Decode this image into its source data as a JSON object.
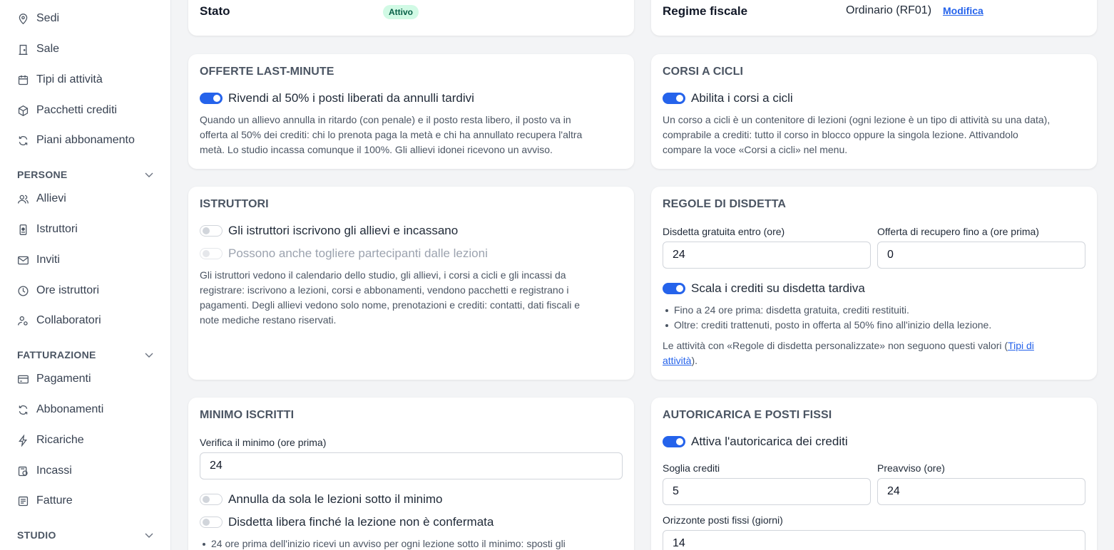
{
  "sidebar": {
    "top_items": [
      {
        "label": "Sedi",
        "icon": "map-pin-icon"
      },
      {
        "label": "Sale",
        "icon": "door-icon"
      },
      {
        "label": "Tipi di attività",
        "icon": "calendar-icon"
      },
      {
        "label": "Pacchetti crediti",
        "icon": "package-icon"
      },
      {
        "label": "Piani abbonamento",
        "icon": "refresh-icon"
      }
    ],
    "sections": {
      "persone": {
        "label": "PERSONE",
        "items": [
          {
            "label": "Allievi",
            "icon": "users-icon"
          },
          {
            "label": "Istruttori",
            "icon": "badge-icon"
          },
          {
            "label": "Inviti",
            "icon": "mail-icon"
          },
          {
            "label": "Ore istruttori",
            "icon": "clock-icon"
          },
          {
            "label": "Collaboratori",
            "icon": "user-cog-icon"
          }
        ]
      },
      "fatturazione": {
        "label": "FATTURAZIONE",
        "items": [
          {
            "label": "Pagamenti",
            "icon": "credit-card-icon"
          },
          {
            "label": "Abbonamenti",
            "icon": "refresh-icon"
          },
          {
            "label": "Ricariche",
            "icon": "lightning-icon"
          },
          {
            "label": "Incassi",
            "icon": "cash-register-icon"
          },
          {
            "label": "Fatture",
            "icon": "invoice-icon"
          }
        ]
      },
      "studio": {
        "label": "STUDIO"
      }
    }
  },
  "status_card": {
    "label": "Stato",
    "badge": "Attivo"
  },
  "tax_card": {
    "label": "Regime fiscale",
    "value": "Ordinario (RF01)",
    "edit_link": "Modifica"
  },
  "last_minute": {
    "title": "OFFERTE LAST-MINUTE",
    "toggle_label": "Rivendi al 50% i posti liberati da annulli tardivi",
    "toggle_on": true,
    "desc": [
      "Quando un allievo annulla in ritardo (con penale) e il posto resta libero, il posto va in",
      "offerta al 50% dei crediti: chi lo prenota paga la metà e chi ha annullato recupera l'altra",
      "metà. Lo studio incassa comunque il 100%. Gli allievi idonei ricevono un avviso."
    ]
  },
  "cycles": {
    "title": "CORSI A CICLI",
    "toggle_label": "Abilita i corsi a cicli",
    "toggle_on": true,
    "desc": [
      "Un corso a cicli è un contenitore di lezioni (ogni lezione è un tipo di attività su una data),",
      "comprabile a crediti: tutto il corso in blocco oppure la singola lezione. Attivandolo",
      "compare la voce «Corsi a cicli» nel menu."
    ]
  },
  "instructors": {
    "title": "ISTRUTTORI",
    "toggle1_label": "Gli istruttori iscrivono gli allievi e incassano",
    "toggle2_label": "Possono anche togliere partecipanti dalle lezioni",
    "desc": [
      "Gli istruttori vedono il calendario dello studio, gli allievi, i corsi a cicli e gli incassi da",
      "registrare: iscrivono a lezioni, corsi e abbonamenti, vendono pacchetti e registrano i",
      "pagamenti. Degli allievi vedono solo nome, prenotazioni e crediti: contatti, dati fiscali e",
      "note mediche restano riservati."
    ]
  },
  "cancellation": {
    "title": "REGOLE DI DISDETTA",
    "free_label": "Disdetta gratuita entro (ore)",
    "free_value": "24",
    "recovery_label": "Offerta di recupero fino a (ore prima)",
    "recovery_value": "0",
    "toggle_label": "Scala i crediti su disdetta tardiva",
    "toggle_on": true,
    "bullets": [
      "Fino a 24 ore prima: disdetta gratuita, crediti restituiti.",
      "Oltre: crediti trattenuti, posto in offerta al 50% fino all'inizio della lezione."
    ],
    "note_before": "Le attività con «Regole di disdetta personalizzate» non seguono questi valori (",
    "note_link_1": "Tipi di",
    "note_link_2": "attività",
    "note_after": ")."
  },
  "minimum": {
    "title": "MINIMO ISCRITTI",
    "check_label": "Verifica il minimo (ore prima)",
    "check_value": "24",
    "toggle1_label": "Annulla da sola le lezioni sotto il minimo",
    "toggle2_label": "Disdetta libera finché la lezione non è confermata",
    "bullet": "24 ore prima dell'inizio ricevi un avviso per ogni lezione sotto il minimo: sposti gli"
  },
  "autorecharge": {
    "title": "AUTORICARICA E POSTI FISSI",
    "toggle_label": "Attiva l'autoricarica dei crediti",
    "toggle_on": true,
    "threshold_label": "Soglia crediti",
    "threshold_value": "5",
    "notice_label": "Preavviso (ore)",
    "notice_value": "24",
    "horizon_label": "Orizzonte posti fissi (giorni)",
    "horizon_value": "14"
  }
}
